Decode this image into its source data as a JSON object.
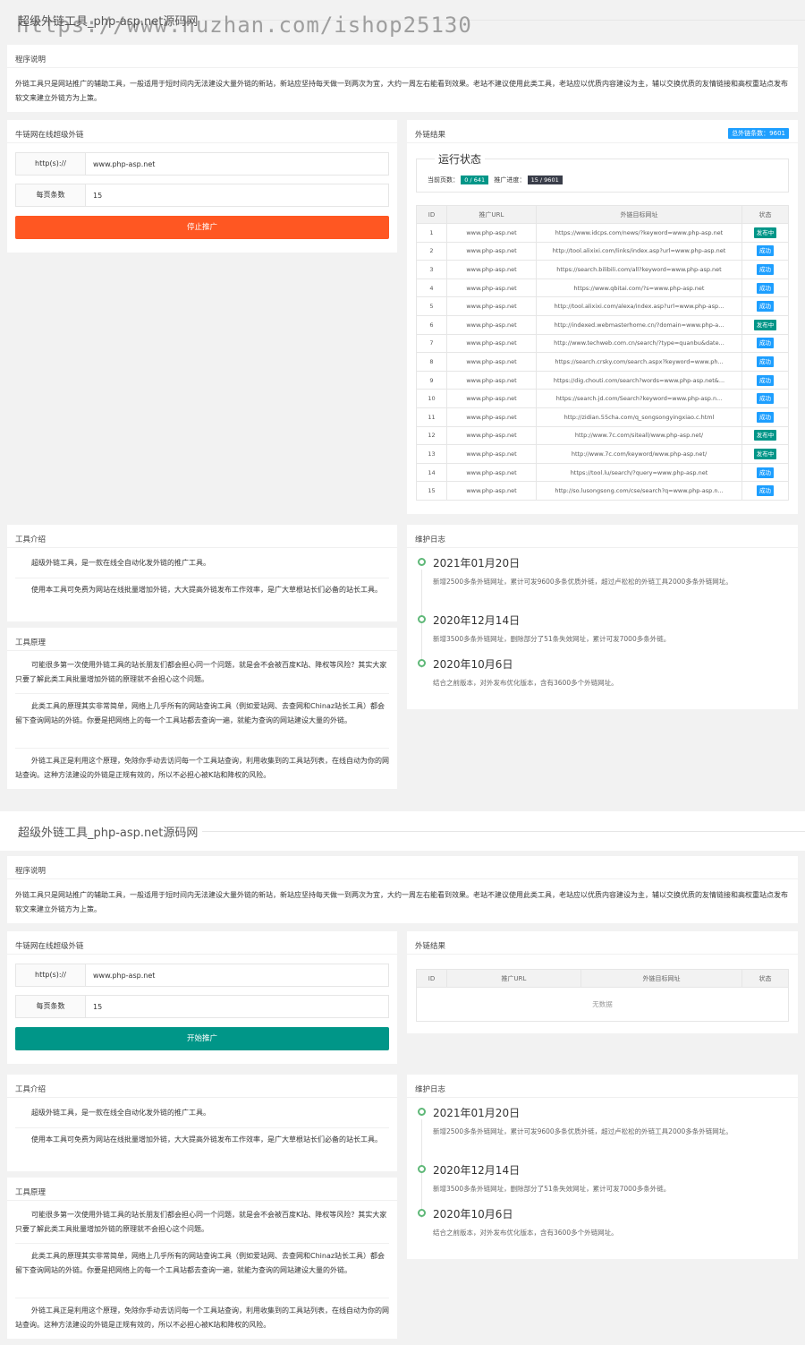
{
  "page_title": "超级外链工具_php-asp.net源码网",
  "watermark": "https://www.huzhan.com/ishop25130",
  "intro": {
    "title": "程序说明",
    "text": "外链工具只是网站推广的辅助工具，一般适用于短时间内无法建设大量外链的新站，新站应坚持每天做一到两次为宜，大约一周左右能看到效果。老站不建议使用此类工具，老站应以优质内容建设为主，辅以交换优质的友情链接和高权重站点发布软文来建立外链方为上策。"
  },
  "form": {
    "title": "牛链网在线超级外链",
    "url_label": "http(s)://",
    "url_value": "www.php-asp.net",
    "per_page_label": "每页条数",
    "per_page_value": "15",
    "stop_button": "停止推广",
    "start_button": "开始推广"
  },
  "results": {
    "title": "外链结果",
    "total_badge": "总外链条数：9601",
    "status_box_title": "运行状态",
    "current_page_label": "当前页数：",
    "current_page_value": "0 / 641",
    "progress_label": "推广进度：",
    "progress_value": "15 / 9601",
    "columns": [
      "ID",
      "推广URL",
      "外链目标网址",
      "状态"
    ],
    "empty_text": "无数据",
    "rows": [
      {
        "id": "1",
        "url": "www.php-asp.net",
        "target": "https://www.idcps.com/news/?keyword=www.php-asp.net",
        "status": "发布中",
        "kind": "pub"
      },
      {
        "id": "2",
        "url": "www.php-asp.net",
        "target": "http://tool.alixixi.com/links/index.asp?url=www.php-asp.net",
        "status": "成功",
        "kind": "ok"
      },
      {
        "id": "3",
        "url": "www.php-asp.net",
        "target": "https://search.bilibili.com/all?keyword=www.php-asp.net",
        "status": "成功",
        "kind": "ok"
      },
      {
        "id": "4",
        "url": "www.php-asp.net",
        "target": "https://www.qbitai.com/?s=www.php-asp.net",
        "status": "成功",
        "kind": "ok"
      },
      {
        "id": "5",
        "url": "www.php-asp.net",
        "target": "http://tool.alixixi.com/alexa/index.asp?url=www.php-asp...",
        "status": "成功",
        "kind": "ok"
      },
      {
        "id": "6",
        "url": "www.php-asp.net",
        "target": "http://indexed.webmasterhome.cn/?domain=www.php-a...",
        "status": "发布中",
        "kind": "pub"
      },
      {
        "id": "7",
        "url": "www.php-asp.net",
        "target": "http://www.techweb.com.cn/search/?type=quanbu&date...",
        "status": "成功",
        "kind": "ok"
      },
      {
        "id": "8",
        "url": "www.php-asp.net",
        "target": "https://search.crsky.com/search.aspx?keyword=www.ph...",
        "status": "成功",
        "kind": "ok"
      },
      {
        "id": "9",
        "url": "www.php-asp.net",
        "target": "https://dig.chouti.com/search?words=www.php-asp.net&...",
        "status": "成功",
        "kind": "ok"
      },
      {
        "id": "10",
        "url": "www.php-asp.net",
        "target": "https://search.jd.com/Search?keyword=www.php-asp.n...",
        "status": "成功",
        "kind": "ok"
      },
      {
        "id": "11",
        "url": "www.php-asp.net",
        "target": "http://zidian.55cha.com/q_songsongyingxiao.c.html",
        "status": "成功",
        "kind": "ok"
      },
      {
        "id": "12",
        "url": "www.php-asp.net",
        "target": "http://www.7c.com/siteall/www.php-asp.net/",
        "status": "发布中",
        "kind": "pub"
      },
      {
        "id": "13",
        "url": "www.php-asp.net",
        "target": "http://www.7c.com/keyword/www.php-asp.net/",
        "status": "发布中",
        "kind": "pub"
      },
      {
        "id": "14",
        "url": "www.php-asp.net",
        "target": "https://tool.lu/search/?query=www.php-asp.net",
        "status": "成功",
        "kind": "ok"
      },
      {
        "id": "15",
        "url": "www.php-asp.net",
        "target": "http://so.lusongsong.com/cse/search?q=www.php-asp.n...",
        "status": "成功",
        "kind": "ok"
      }
    ]
  },
  "tool_intro": {
    "title": "工具介绍",
    "p1": "超级外链工具，是一款在线全自动化发外链的推广工具。",
    "p2": "使用本工具可免费为网站在线批量增加外链，大大提高外链发布工作效率，是广大草根站长们必备的站长工具。"
  },
  "principle": {
    "title": "工具原理",
    "p1": "可能很多第一次使用外链工具的站长朋友们都会担心同一个问题，就是会不会被百度K站、降权等风险？其实大家只要了解此类工具批量增加外链的原理就不会担心这个问题。",
    "p2": "此类工具的原理其实非常简单，网络上几乎所有的网站查询工具（例如爱站网、去查网和Chinaz站长工具）都会留下查询网站的外链。你要是把网络上的每一个工具站都去查询一遍，就能为查询的网站建设大量的外链。",
    "p3": "外链工具正是利用这个原理，免除你手动去访问每一个工具站查询，利用收集到的工具站列表，在线自动为你的网站查询。这种方法建设的外链是正规有效的，所以不必担心被K站和降权的风险。"
  },
  "log": {
    "title": "维护日志",
    "entries": [
      {
        "date": "2021年01月20日",
        "desc": "新增2500多条外链网址，累计可发9600多条优质外链，超过卢松松的外链工具2000多条外链网址。"
      },
      {
        "date": "2020年12月14日",
        "desc": "新增3500多条外链网址，删除部分了51条失效网址，累计可发7000多条外链。"
      },
      {
        "date": "2020年10月6日",
        "desc": "结合之前版本，对外发布优化版本，含有3600多个外链网址。"
      }
    ]
  }
}
